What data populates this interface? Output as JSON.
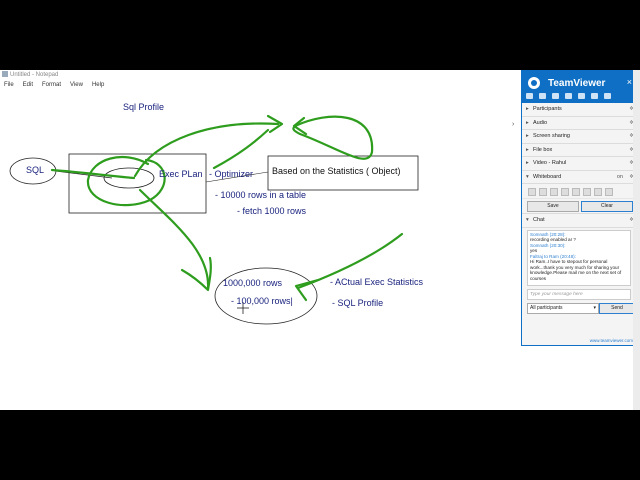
{
  "notepad": {
    "window_title": "Untitled - Notepad",
    "menu": [
      "File",
      "Edit",
      "Format",
      "View",
      "Help"
    ]
  },
  "whiteboard_text": {
    "heading": "Sql Profile",
    "sql": "SQL",
    "exec_plan": "Exec PLan",
    "optimizer": "- Optimizer",
    "based_on": "Based on the Statistics ( Object)",
    "rows_in_table": "- 10000 rows in a table",
    "fetch_rows": "- fetch 1000 rows",
    "rows_big": "1000,000 rows",
    "rows_small": "- 100,000 rows|",
    "actual_exec": "- ACtual Exec Statistics",
    "sql_profile": "- SQL Profile"
  },
  "colors": {
    "ink": "#1a237e",
    "pen": "#2e9d1e",
    "teamviewer_blue": "#0e6fc4"
  },
  "teamviewer": {
    "title": "TeamViewer",
    "close": "×",
    "sections": [
      {
        "label": "Participants",
        "open": false
      },
      {
        "label": "Audio",
        "open": false
      },
      {
        "label": "Screen sharing",
        "open": false
      },
      {
        "label": "File box",
        "open": false
      },
      {
        "label": "Video - Rahul",
        "open": false
      }
    ],
    "whiteboard": {
      "label": "Whiteboard",
      "toggle": "on",
      "save": "Save",
      "clear": "Clear"
    },
    "chat": {
      "label": "Chat",
      "messages": [
        {
          "from": "Somnath (20:28):",
          "text": "recording enabled ar ?"
        },
        {
          "from": "Somnath (20:30):",
          "text": "yes"
        },
        {
          "from": "Faltraj to Ram (20:48):",
          "text": "Hi Ram..I have to stepout for personal work...thank you very much for sharing your knowledge.Please mail me on the next set of courses"
        }
      ],
      "input_placeholder": "Type your message here",
      "recipient": "All participants",
      "send": "Send"
    },
    "site": "www.teamviewer.com"
  }
}
